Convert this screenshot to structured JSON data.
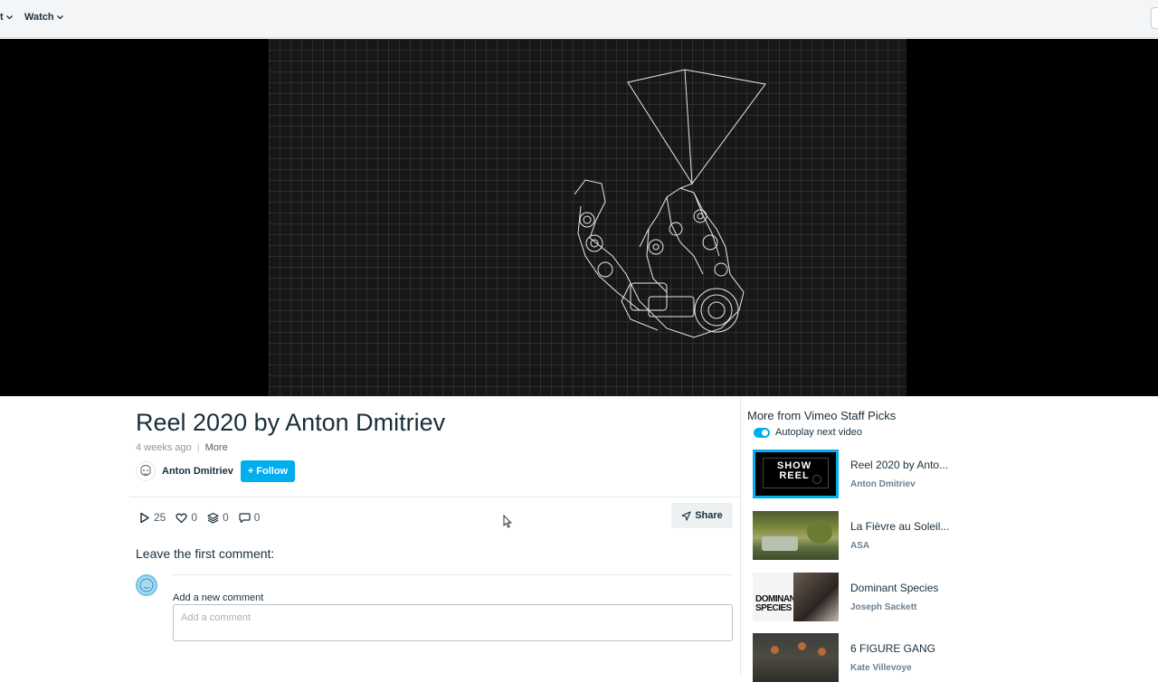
{
  "topbar": {
    "nav_partial_chevron": "t",
    "watch_label": "Watch"
  },
  "video": {
    "title": "Reel 2020 by Anton Dmitriev",
    "age": "4 weeks ago",
    "separator": "|",
    "more_label": "More",
    "owner": "Anton Dmitriev",
    "follow_label": "Follow",
    "follow_plus": "+",
    "stats": {
      "plays": "25",
      "likes": "0",
      "collections": "0",
      "comments": "0"
    },
    "share_label": "Share"
  },
  "comments": {
    "heading": "Leave the first comment:",
    "label": "Add a new comment",
    "placeholder": "Add a comment"
  },
  "sidebar": {
    "title": "More from Vimeo Staff Picks",
    "autoplay_label": "Autoplay next video",
    "autoplay_on": true,
    "items": [
      {
        "title": "Reel 2020 by Anto...",
        "author": "Anton Dmitriev",
        "thumb_text": "SHOW REEL",
        "active": true
      },
      {
        "title": "La Fièvre au Soleil...",
        "author": "ASA"
      },
      {
        "title": "Dominant Species",
        "author": "Joseph Sackett",
        "thumb_text": "DOMINANT SPECIES"
      },
      {
        "title": "6 FIGURE GANG",
        "author": "Kate Villevoye"
      }
    ]
  },
  "colors": {
    "accent": "#00adef",
    "text": "#1a2e3b",
    "muted": "#8a99a4"
  }
}
